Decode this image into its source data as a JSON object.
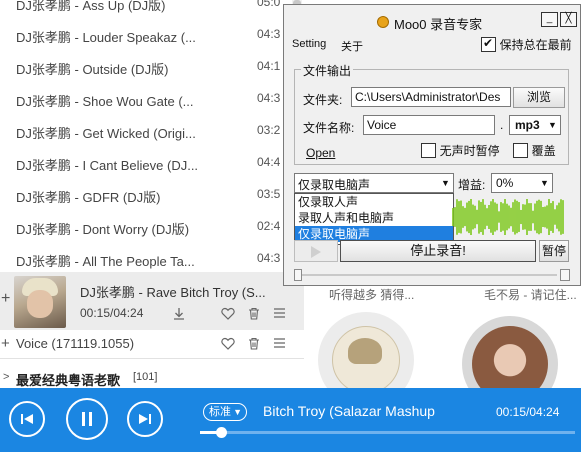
{
  "playlist": {
    "songs": [
      {
        "title": "DJ张孝鹏 - Ass Up (DJ版)",
        "duration": "05:0"
      },
      {
        "title": "DJ张孝鹏 - Louder Speakaz (...",
        "duration": "04:3"
      },
      {
        "title": "DJ张孝鹏 - Outside (DJ版)",
        "duration": "04:1"
      },
      {
        "title": "DJ张孝鹏 - Shoe Wou Gate (...",
        "duration": "04:3"
      },
      {
        "title": "DJ张孝鹏 - Get Wicked (Origi...",
        "duration": "03:2"
      },
      {
        "title": "DJ张孝鹏 - I Cant Believe (DJ...",
        "duration": "04:4"
      },
      {
        "title": "DJ张孝鹏 - GDFR (DJ版)",
        "duration": "03:5"
      },
      {
        "title": "DJ张孝鹏 - Dont Worry (DJ版)",
        "duration": "02:4"
      },
      {
        "title": "DJ张孝鹏 - All The People Ta...",
        "duration": "04:3"
      }
    ],
    "now_playing": {
      "plus": "+",
      "title": "DJ张孝鹏 - Rave Bitch Troy (S...",
      "time": "00:15/04:24"
    },
    "voice": {
      "plus": "+",
      "label": "Voice (171119.1055)"
    },
    "group": {
      "arrow": ">",
      "label": "最爱经典粤语老歌",
      "count": "[101]"
    }
  },
  "right_panel": {
    "caption_left": "听得越多 猜得...",
    "caption_right": "毛不易 - 请记住..."
  },
  "moo0": {
    "title": "Moo0 录音专家",
    "menu": {
      "setting": "Setting",
      "about": "关于"
    },
    "window_min": "_",
    "window_close": "╳",
    "always_on_top": {
      "label": "保持总在最前",
      "checked": true
    },
    "file_output": {
      "legend": "文件输出",
      "folder_label": "文件夹:",
      "folder_value": "C:\\Users\\Administrator\\Des",
      "browse_label": "浏览",
      "name_label": "文件名称:",
      "name_value": "Voice",
      "dot": ".",
      "format": "mp3",
      "open_link": "Open",
      "pause_silence": {
        "label": "无声时暂停",
        "checked": false
      },
      "overwrite": {
        "label": "覆盖",
        "checked": false
      }
    },
    "source": {
      "selected": "仅录取电脑声",
      "options": [
        "仅录取人声",
        "录取人声和电脑声",
        "仅录取电脑声"
      ],
      "highlighted_index": 2
    },
    "gain": {
      "label": "增益:",
      "value": "0%"
    },
    "stop_button": "停止录音!",
    "pause_button": "暂停",
    "colors": {
      "wave": "#7ec81c",
      "selection": "#1f7fe0"
    }
  },
  "player": {
    "quality": "标准",
    "title": "Bitch Troy (Salazar Mashup",
    "time": "00:15/04:24",
    "progress": 0.057,
    "icons": {
      "prev": "prev-icon",
      "pause": "pause-icon",
      "next": "next-icon"
    },
    "colors": {
      "bar": "#1b86e2"
    }
  }
}
